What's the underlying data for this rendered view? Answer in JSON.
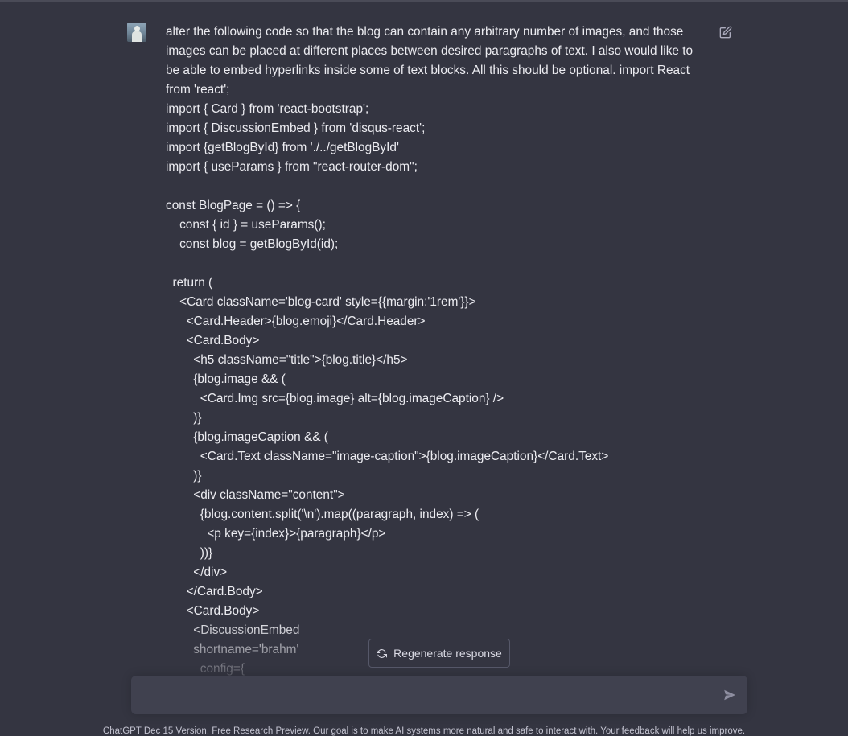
{
  "message": {
    "prose": "alter the following code so that the blog can contain any arbitrary number of images, and those images can be placed at different places between desired paragraphs of text. I also would like to be able to embed hyperlinks inside some of text blocks. All this should be optional. import React from 'react';",
    "code_lines": [
      "import { Card } from 'react-bootstrap';",
      "import { DiscussionEmbed } from 'disqus-react';",
      "import {getBlogById} from './../getBlogById'",
      "import { useParams } from \"react-router-dom\";",
      "",
      "const BlogPage = () => {",
      "    const { id } = useParams();",
      "    const blog = getBlogById(id);",
      "",
      "  return (",
      "    <Card className='blog-card' style={{margin:'1rem'}}>",
      "      <Card.Header>{blog.emoji}</Card.Header>",
      "      <Card.Body>",
      "        <h5 className=\"title\">{blog.title}</h5>",
      "        {blog.image && (",
      "          <Card.Img src={blog.image} alt={blog.imageCaption} />",
      "        )}",
      "        {blog.imageCaption && (",
      "          <Card.Text className=\"image-caption\">{blog.imageCaption}</Card.Text>",
      "        )}",
      "        <div className=\"content\">",
      "          {blog.content.split('\\n').map((paragraph, index) => (",
      "            <p key={index}>{paragraph}</p>",
      "          ))}",
      "        </div>",
      "      </Card.Body>",
      "      <Card.Body>",
      "        <DiscussionEmbed",
      "        shortname='brahm'",
      "          config={"
    ]
  },
  "regenerate_button": {
    "label": "Regenerate response",
    "icon": "refresh-icon"
  },
  "input": {
    "value": "",
    "placeholder": ""
  },
  "footer": {
    "text": "ChatGPT Dec 15 Version. Free Research Preview. Our goal is to make AI systems more natural and safe to interact with. Your feedback will help us improve."
  },
  "colors": {
    "background": "#343541",
    "text": "#ececf1",
    "input_background": "#40414f",
    "button_border": "#565869"
  }
}
